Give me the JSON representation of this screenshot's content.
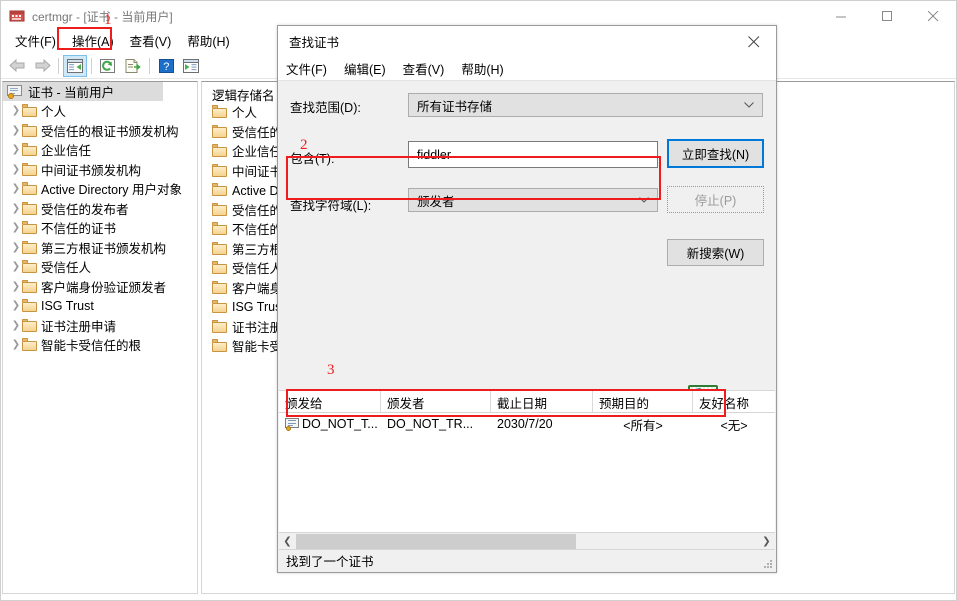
{
  "main_window": {
    "title": "certmgr - [证书 - 当前用户]",
    "icon": "certmgr-icon",
    "window_controls": {
      "minimize": "–",
      "maximize": "□",
      "close": "✕"
    },
    "menus": [
      {
        "label": "文件(F)",
        "name": "menu-file"
      },
      {
        "label": "操作(A)",
        "name": "menu-action"
      },
      {
        "label": "查看(V)",
        "name": "menu-view"
      },
      {
        "label": "帮助(H)",
        "name": "menu-help"
      }
    ],
    "toolbar": [
      {
        "name": "back-icon",
        "glyph": "⬅"
      },
      {
        "name": "forward-icon",
        "glyph": "➡"
      },
      {
        "name": "show-hide-tree-icon",
        "glyph": ""
      },
      {
        "name": "refresh-icon",
        "glyph": ""
      },
      {
        "name": "export-list-icon",
        "glyph": ""
      },
      {
        "name": "help-icon",
        "glyph": "?"
      },
      {
        "name": "show-action-pane-icon",
        "glyph": ""
      }
    ]
  },
  "tree_pane": {
    "root_label": "证书 - 当前用户",
    "items": [
      {
        "label": "个人"
      },
      {
        "label": "受信任的根证书颁发机构"
      },
      {
        "label": "企业信任"
      },
      {
        "label": "中间证书颁发机构"
      },
      {
        "label": "Active Directory 用户对象"
      },
      {
        "label": "受信任的发布者"
      },
      {
        "label": "不信任的证书"
      },
      {
        "label": "第三方根证书颁发机构"
      },
      {
        "label": "受信任人"
      },
      {
        "label": "客户端身份验证颁发者"
      },
      {
        "label": "ISG Trust"
      },
      {
        "label": "证书注册申请"
      },
      {
        "label": "智能卡受信任的根"
      }
    ]
  },
  "list_pane": {
    "column_header": "逻辑存储名",
    "items": [
      {
        "label": "个人"
      },
      {
        "label": "受信任的根证书颁发机构"
      },
      {
        "label": "企业信任"
      },
      {
        "label": "中间证书颁发机构"
      },
      {
        "label": "Active Directory 用户对象"
      },
      {
        "label": "受信任的发布者"
      },
      {
        "label": "不信任的证书"
      },
      {
        "label": "第三方根证书颁发机构"
      },
      {
        "label": "受信任人"
      },
      {
        "label": "客户端身份验证颁发者"
      },
      {
        "label": "ISG Trust"
      },
      {
        "label": "证书注册申请"
      },
      {
        "label": "智能卡受信任的根"
      }
    ]
  },
  "find_dialog": {
    "title": "查找证书",
    "close_label": "✕",
    "menus": [
      {
        "label": "文件(F)",
        "name": "dlg-menu-file"
      },
      {
        "label": "编辑(E)",
        "name": "dlg-menu-edit"
      },
      {
        "label": "查看(V)",
        "name": "dlg-menu-view"
      },
      {
        "label": "帮助(H)",
        "name": "dlg-menu-help"
      }
    ],
    "scope": {
      "label": "查找范围(D):",
      "value": "所有证书存储"
    },
    "contains": {
      "label": "包含(T):",
      "value": "fiddler",
      "placeholder": ""
    },
    "field": {
      "label": "查找字符域(L):",
      "value": "颁发者"
    },
    "buttons": {
      "find_now": "立即查找(N)",
      "stop": "停止(P)",
      "new_search": "新搜索(W)"
    },
    "search_anim_icon": "certificate-search-icon",
    "results": {
      "columns": [
        "颁发给",
        "颁发者",
        "截止日期",
        "预期目的",
        "友好名称"
      ],
      "rows": [
        {
          "issued_to": "DO_NOT_T...",
          "issuer": "DO_NOT_TR...",
          "expiry": "2030/7/20",
          "purpose": "<所有>",
          "friendly_name": "<无>"
        }
      ]
    },
    "status_text": "找到了一个证书",
    "hscroll": {
      "left_glyph": "❮",
      "right_glyph": "❯"
    }
  },
  "annotations": [
    {
      "number": "1",
      "target": "menu-action"
    },
    {
      "number": "2",
      "target": "contains-field-row"
    },
    {
      "number": "3",
      "target": "results-row"
    }
  ],
  "colors": {
    "annotation_red": "#ee1c1c",
    "accent_blue": "#0078d7",
    "selection_gray": "#dcdcdc",
    "dialog_bg": "#f0f0f0"
  }
}
